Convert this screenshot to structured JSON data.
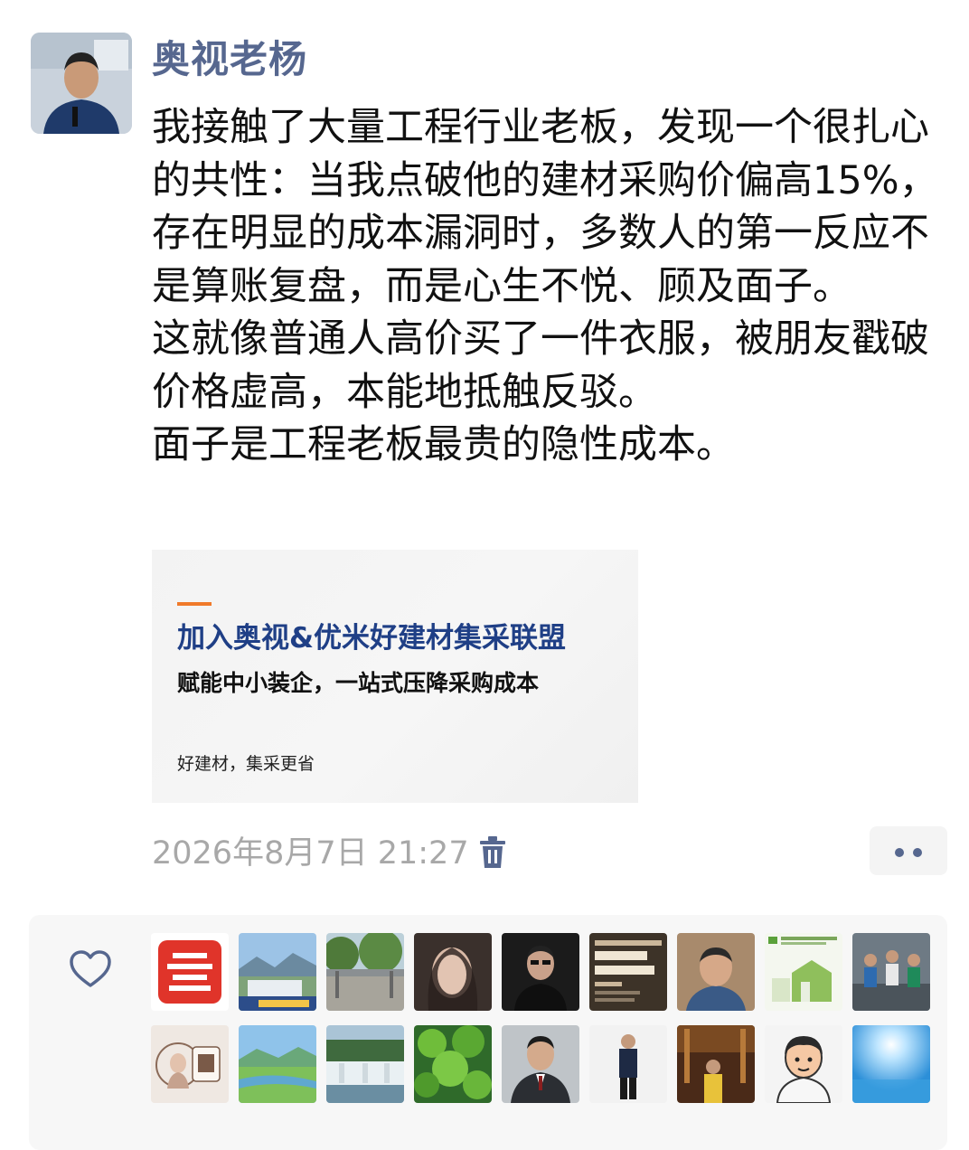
{
  "post": {
    "username": "奥视老杨",
    "paragraphs": [
      "我接触了大量工程行业老板，发现一个很扎心的共性：当我点破他的建材采购价偏高15%，存在明显的成本漏洞时，多数人的第一反应不是算账复盘，而是心生不悦、顾及面子。",
      "这就像普通人高价买了一件衣服，被朋友戳破价格虚高，本能地抵触反驳。",
      "面子是工程老板最贵的隐性成本。"
    ],
    "timestamp": "2026年8月7日 21:27"
  },
  "link_card": {
    "title": "加入奥视&优米好建材集采联盟",
    "subtitle": "赋能中小装企，一站式压降采购成本",
    "tagline": "好建材，集采更省"
  },
  "icons": {
    "delete": "trash-icon",
    "more": "more-dots-icon",
    "like": "heart-icon"
  },
  "colors": {
    "username": "#56678f",
    "link_title": "#1f3f86",
    "accent": "#f07a2a",
    "timestamp": "#a8a8a8"
  }
}
